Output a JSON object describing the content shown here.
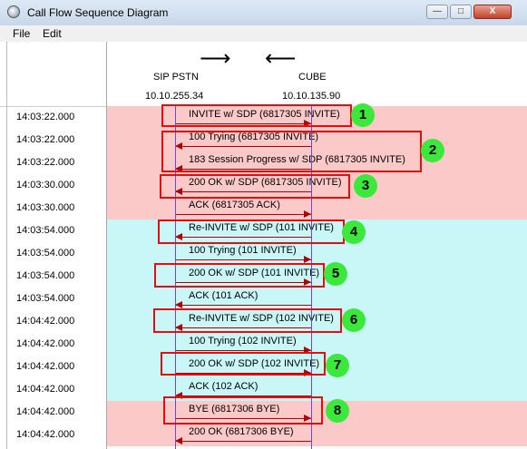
{
  "window": {
    "title": "Call Flow Sequence Diagram",
    "min_label": "—",
    "max_label": "□",
    "close_label": "X"
  },
  "menu": {
    "file": "File",
    "edit": "Edit"
  },
  "header": {
    "arrow_right": "⟶",
    "arrow_left": "⟵",
    "left_party": {
      "name": "SIP PSTN",
      "ip": "10.10.255.34"
    },
    "right_party": {
      "name": "CUBE",
      "ip": "10.10.135.90"
    }
  },
  "messages": [
    {
      "time": "14:03:22.000",
      "label": "INVITE w/ SDP (6817305 INVITE)",
      "direction": "right",
      "band": "pink"
    },
    {
      "time": "14:03:22.000",
      "label": "100 Trying (6817305 INVITE)",
      "direction": "left",
      "band": "pink"
    },
    {
      "time": "14:03:22.000",
      "label": "183 Session Progress w/ SDP (6817305 INVITE)",
      "direction": "left",
      "band": "pink"
    },
    {
      "time": "14:03:30.000",
      "label": "200 OK w/ SDP (6817305 INVITE)",
      "direction": "left",
      "band": "pink"
    },
    {
      "time": "14:03:30.000",
      "label": "ACK (6817305 ACK)",
      "direction": "right",
      "band": "pink"
    },
    {
      "time": "14:03:54.000",
      "label": "Re-INVITE w/ SDP (101 INVITE)",
      "direction": "left",
      "band": "cyan"
    },
    {
      "time": "14:03:54.000",
      "label": "100 Trying (101 INVITE)",
      "direction": "right",
      "band": "cyan"
    },
    {
      "time": "14:03:54.000",
      "label": "200 OK w/ SDP (101 INVITE)",
      "direction": "right",
      "band": "cyan"
    },
    {
      "time": "14:03:54.000",
      "label": "ACK (101 ACK)",
      "direction": "left",
      "band": "cyan"
    },
    {
      "time": "14:04:42.000",
      "label": "Re-INVITE w/ SDP (102 INVITE)",
      "direction": "left",
      "band": "cyan"
    },
    {
      "time": "14:04:42.000",
      "label": "100 Trying (102 INVITE)",
      "direction": "right",
      "band": "cyan"
    },
    {
      "time": "14:04:42.000",
      "label": "200 OK w/ SDP (102 INVITE)",
      "direction": "right",
      "band": "cyan"
    },
    {
      "time": "14:04:42.000",
      "label": "ACK (102 ACK)",
      "direction": "left",
      "band": "cyan"
    },
    {
      "time": "14:04:42.000",
      "label": "BYE (6817306 BYE)",
      "direction": "right",
      "band": "pink"
    },
    {
      "time": "14:04:42.000",
      "label": "200 OK (6817306 BYE)",
      "direction": "left",
      "band": "pink"
    }
  ],
  "annotations": [
    "1",
    "2",
    "3",
    "4",
    "5",
    "6",
    "7",
    "8"
  ],
  "colors": {
    "pink_band": "#fcc9c9",
    "cyan_band": "#c9f6f6",
    "arrow": "#b00000",
    "highlight": "#e01010",
    "badge": "#3be83b",
    "lifeline": "#6a4ad0"
  }
}
